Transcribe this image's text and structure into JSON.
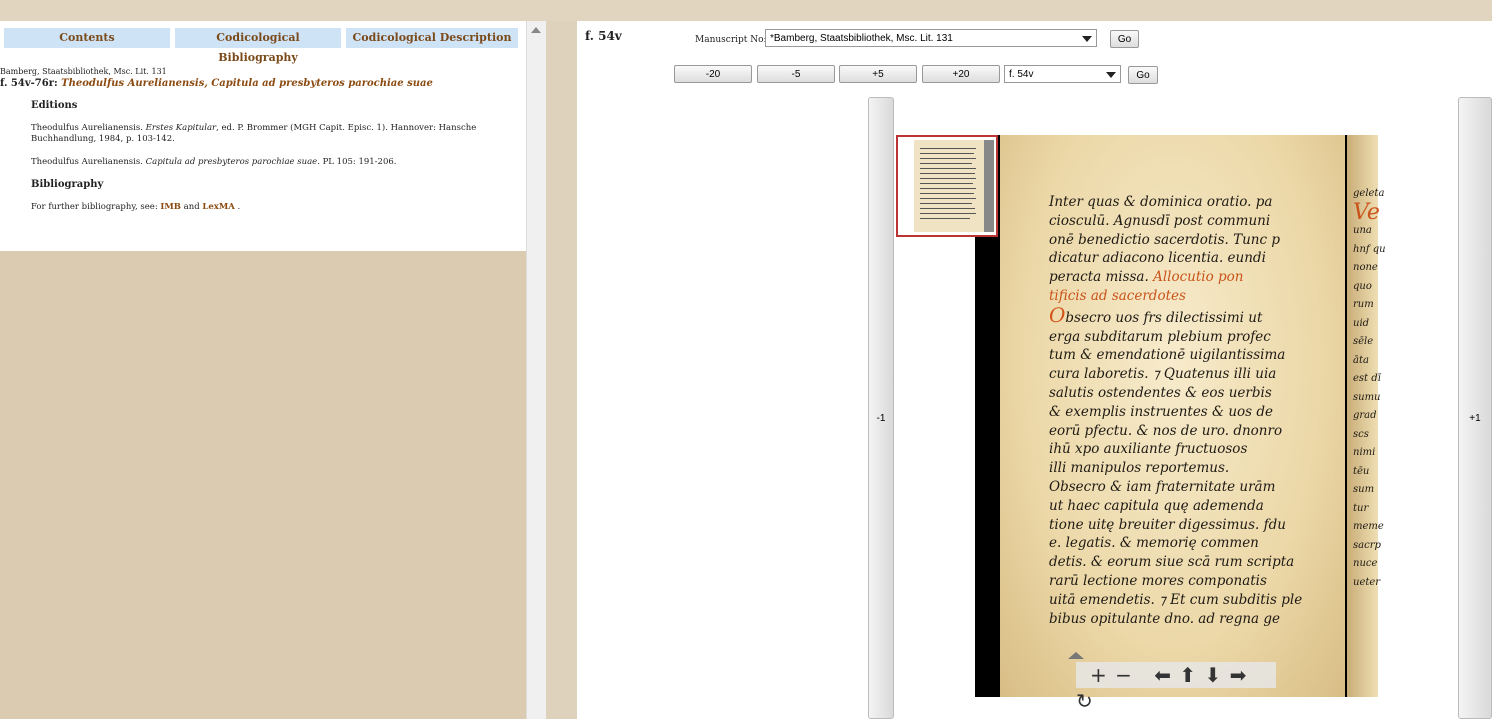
{
  "tabs": [
    "Contents",
    "Codicological Bibliography",
    "Codicological Description"
  ],
  "entry": {
    "manuscript": "Bamberg, Staatsbibliothek, Msc. Lit. 131",
    "folios": "f. 54v-76r: ",
    "work": "Theodulfus Aurelianensis, Capitula ad presbyteros parochiae suae"
  },
  "editions": {
    "heading": "Editions",
    "items": [
      {
        "prefix": "Theodulfus Aurelianensis. ",
        "title": "Erstes Kapitular",
        "suffix": ", ed. P. Brommer (MGH Capit. Episc. 1). Hannover: Hansche Buchhandlung, 1984, p. 103-142."
      },
      {
        "prefix": "Theodulfus Aurelianensis. ",
        "title": "Capitula ad presbyteros parochiae suae",
        "suffix": ". PL 105: 191-206."
      }
    ]
  },
  "bibliography": {
    "heading": "Bibliography",
    "text": "For further bibliography, see: ",
    "link1": "IMB",
    "and": " and ",
    "link2": "LexMA",
    "end": " ."
  },
  "viewer": {
    "folio": "f. 54v",
    "manuscript_label": "Manuscript No:",
    "manuscript_value": "*Bamberg, Staatsbibliothek, Msc. Lit. 131",
    "go": "Go",
    "nav": [
      "-20",
      "-5",
      "+5",
      "+20"
    ],
    "folio_select": "f. 54v",
    "prev": "-1",
    "next": "+1",
    "controls": [
      "+",
      "−",
      "⬅",
      "⬆",
      "⬇",
      "➡",
      "↻"
    ],
    "colors": {
      "link": "#8b4a10",
      "tab": "#cfe3f7",
      "rubric": "#c9531a"
    }
  },
  "manuscript_text": {
    "lines": [
      "Inter quas & dominica oratio. pa",
      "ciosculū. Agnusdī   post communi",
      "onē benedictio sacerdotis. Tunc p",
      "dicatur adiacono licentia. eundi",
      "peracta missa.",
      "",
      "bsecro uos frs dilectissimi ut",
      "erga subditarum plebium profec",
      "tum & emendationē uigilantissima",
      "cura laboretis. ⁊ Quatenus illi uia",
      "salutis ostendentes & eos uerbis",
      "& exemplis instruentes & uos de",
      "eorū pfectu. & nos de uro. dnonro",
      "ihū xpo auxiliante fructuosos",
      "illi manipulos reportemus.",
      "bsecro & iam fraternitate urām",
      "ut haec capitula quę ademenda",
      "tione uitę breuiter digessimus. fdu",
      "e. legatis. & memorię commen",
      "detis. & eorum siue scā rum scripta",
      "rarū lectione mores componatis",
      "uitā emendetis. ⁊ Et cum subditis ple",
      "bibus opitulante dno. ad regna ge"
    ],
    "rubric1": "Allocutio pon",
    "rubric2": "tificis ad sacerdotes",
    "initial": "O",
    "initial2": "O",
    "facing": [
      "geleta",
      "Ve",
      "una",
      "hnf qu",
      "none",
      "quo",
      "rum",
      "uid",
      "sēle",
      "āta",
      "est dī",
      "sumu",
      "grad",
      "scs",
      "nimi",
      "tēu",
      "sum",
      "tur",
      "meme",
      "sacrp",
      "nuce",
      "ueter"
    ]
  }
}
